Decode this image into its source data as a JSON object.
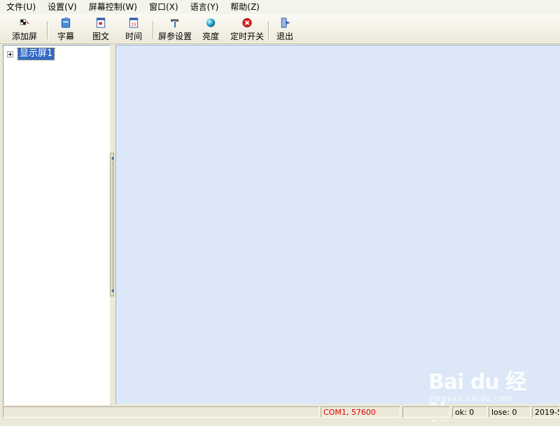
{
  "menu": [
    {
      "label": "文件(U)"
    },
    {
      "label": "设置(V)"
    },
    {
      "label": "屏幕控制(W)"
    },
    {
      "label": "窗口(X)"
    },
    {
      "label": "语言(Y)"
    },
    {
      "label": "帮助(Z)"
    }
  ],
  "toolbar": {
    "add_screen": {
      "label": "添加屏",
      "icon": "add-screen-icon"
    },
    "subtitle": {
      "label": "字幕",
      "icon": "subtitle-icon"
    },
    "graphic": {
      "label": "图文",
      "icon": "image-text-icon"
    },
    "time": {
      "label": "时间",
      "icon": "calendar-icon",
      "icon_text": "15"
    },
    "screen_settings": {
      "label": "屏参设置",
      "icon": "hammer-icon"
    },
    "brightness": {
      "label": "亮度",
      "icon": "brightness-icon"
    },
    "timer_switch": {
      "label": "定时开关",
      "icon": "power-off-icon"
    },
    "exit": {
      "label": "退出",
      "icon": "exit-door-icon"
    }
  },
  "tree": {
    "nodes": [
      {
        "label": "显示屏1",
        "expanded": false,
        "selected": true
      }
    ]
  },
  "statusbar": {
    "port": "COM1, 57600",
    "ok": "ok: 0",
    "lose": "lose: 0",
    "date": "2019-5-"
  },
  "watermark": {
    "logo": "Bai du 经验",
    "sub": "jingyan.baidu.com"
  },
  "colors": {
    "workspace": "#dce8f7",
    "selection": "#316ac5",
    "port_text": "#e00000",
    "chrome": "#ece9d8"
  }
}
